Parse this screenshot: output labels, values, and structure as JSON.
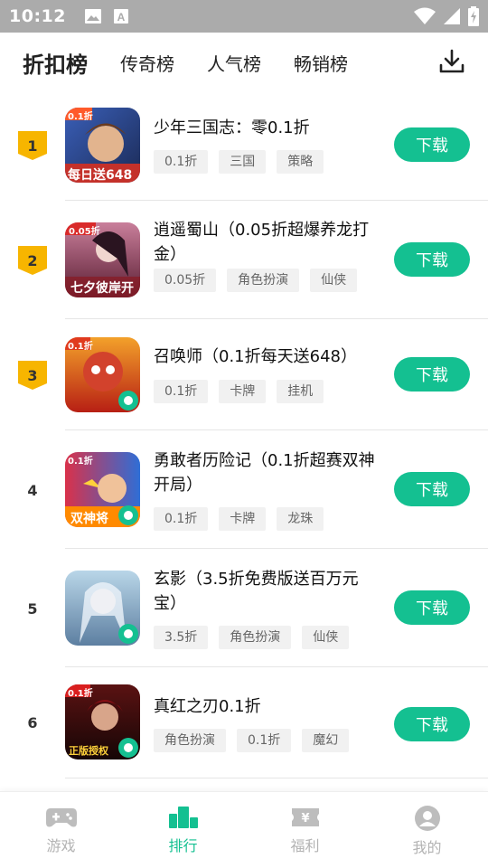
{
  "status": {
    "time": "10:12",
    "icons": [
      "image-icon",
      "font-icon",
      "wifi-icon",
      "signal-icon",
      "battery-charging-icon"
    ]
  },
  "tabs": [
    {
      "label": "折扣榜",
      "active": true
    },
    {
      "label": "传奇榜",
      "active": false
    },
    {
      "label": "人气榜",
      "active": false
    },
    {
      "label": "畅销榜",
      "active": false
    }
  ],
  "download_manager_icon": "download-tray-icon",
  "items": [
    {
      "rank": "1",
      "title": "少年三国志：零0.1折",
      "tags": [
        "0.1折",
        "三国",
        "策略"
      ],
      "button": "下载",
      "icon_badge": "0.1折",
      "icon_caption": "每日送648"
    },
    {
      "rank": "2",
      "title": "逍遥蜀山（0.05折超爆养龙打金）",
      "tags": [
        "0.05折",
        "角色扮演",
        "仙侠"
      ],
      "button": "下载",
      "icon_badge": "0.05折",
      "icon_caption": "七夕彼岸开"
    },
    {
      "rank": "3",
      "title": "召唤师（0.1折每天送648）",
      "tags": [
        "0.1折",
        "卡牌",
        "挂机"
      ],
      "button": "下载",
      "icon_badge": "0.1折",
      "icon_caption": ""
    },
    {
      "rank": "4",
      "title": "勇敢者历险记（0.1折超赛双神开局）",
      "tags": [
        "0.1折",
        "卡牌",
        "龙珠"
      ],
      "button": "下载",
      "icon_badge": "0.1折",
      "icon_caption": "双神将"
    },
    {
      "rank": "5",
      "title": "玄影（3.5折免费版送百万元宝）",
      "tags": [
        "3.5折",
        "角色扮演",
        "仙侠"
      ],
      "button": "下载",
      "icon_badge": "",
      "icon_caption": ""
    },
    {
      "rank": "6",
      "title": "真红之刃0.1折",
      "tags": [
        "角色扮演",
        "0.1折",
        "魔幻"
      ],
      "button": "下载",
      "icon_badge": "0.1折",
      "icon_caption": "正版授权"
    }
  ],
  "bottom_nav": [
    {
      "label": "游戏",
      "icon": "gamepad-icon",
      "active": false
    },
    {
      "label": "排行",
      "icon": "ranking-icon",
      "active": true
    },
    {
      "label": "福利",
      "icon": "ticket-icon",
      "active": false
    },
    {
      "label": "我的",
      "icon": "profile-icon",
      "active": false
    }
  ],
  "colors": {
    "accent": "#14c091",
    "medal": "#f7b500",
    "tab_highlight": "#7fe3c8",
    "status_bar": "#ababab"
  }
}
